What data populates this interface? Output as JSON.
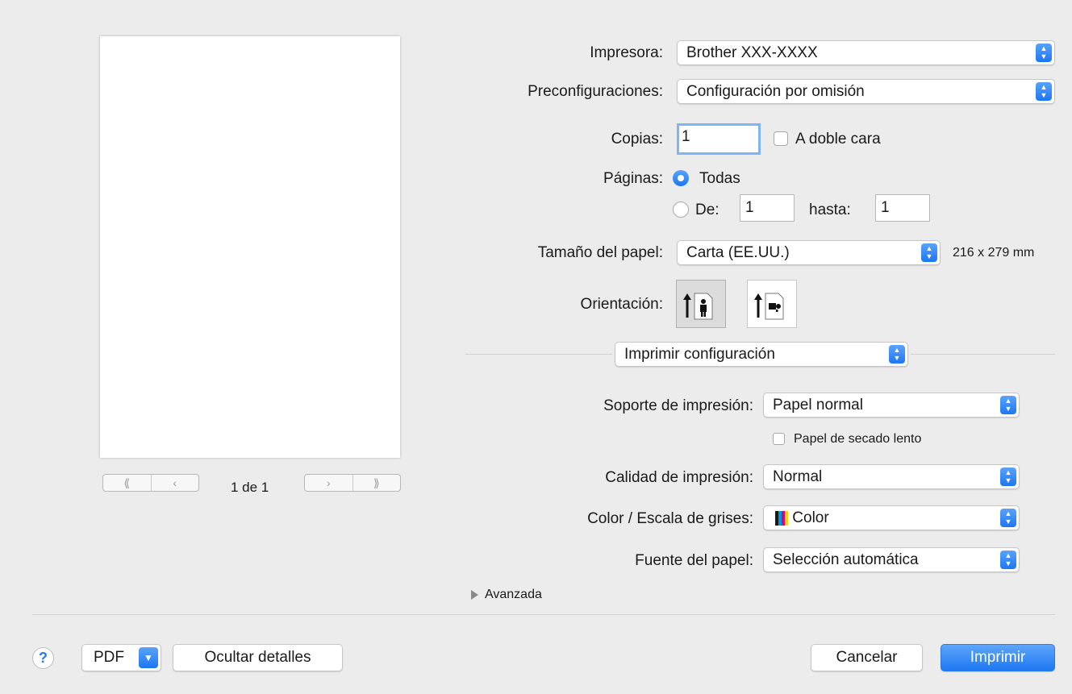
{
  "preview": {
    "page_indicator": "1 de 1",
    "nav": {
      "first": "⟪",
      "prev": "‹",
      "next": "›",
      "last": "⟫"
    }
  },
  "printer": {
    "label": "Impresora:",
    "value": "Brother XXX-XXXX"
  },
  "presets": {
    "label": "Preconfiguraciones:",
    "value": "Configuración por omisión"
  },
  "copies": {
    "label": "Copias:",
    "value": "1",
    "two_sided_label": "A doble cara"
  },
  "pages": {
    "label": "Páginas:",
    "all_label": "Todas",
    "from_label": "De:",
    "from_value": "1",
    "to_label": "hasta:",
    "to_value": "1"
  },
  "paper_size": {
    "label": "Tamaño del papel:",
    "value": "Carta (EE.UU.)",
    "dimensions": "216 x 279 mm"
  },
  "orientation": {
    "label": "Orientación:",
    "portrait_icon": "portrait-orientation-icon",
    "landscape_icon": "landscape-orientation-icon"
  },
  "section": {
    "value": "Imprimir configuración"
  },
  "media_type": {
    "label": "Soporte de impresión:",
    "value": "Papel normal"
  },
  "slow_drying": {
    "label": "Papel de secado lento"
  },
  "quality": {
    "label": "Calidad de impresión:",
    "value": "Normal"
  },
  "color_mode": {
    "label": "Color / Escala de grises:",
    "value": "Color"
  },
  "paper_source": {
    "label": "Fuente del papel:",
    "value": "Selección automática"
  },
  "advanced": {
    "label": "Avanzada"
  },
  "footer": {
    "help": "?",
    "pdf": "PDF",
    "hide_details": "Ocultar detalles",
    "cancel": "Cancelar",
    "print": "Imprimir"
  },
  "colors": {
    "accent": "#1d78f2",
    "color_bars": [
      "#1a1a1a",
      "#0096e0",
      "#e0007a",
      "#f2d600"
    ]
  }
}
